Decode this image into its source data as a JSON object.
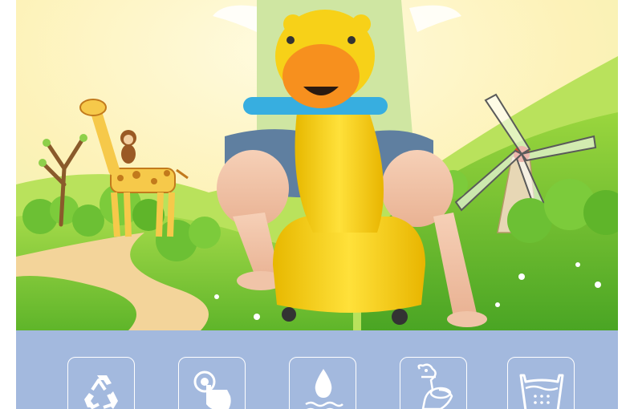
{
  "colors": {
    "sky": "#fdf7c9",
    "grass": "#8fd13c",
    "path": "#f3d49a",
    "toy_yellow": "#f7d118",
    "toy_face": "#f7901e",
    "handle": "#37aee0",
    "feature_band": "#a3b9de",
    "icon_stroke": "#ffffff"
  },
  "hero": {
    "image": "child-riding-giraffe-potty-in-cartoon-meadow",
    "elements": [
      "giraffe-cartoon",
      "monkey-cartoon",
      "tree-cartoon",
      "windmill",
      "hills",
      "bushes",
      "child",
      "giraffe-potty-toy"
    ]
  },
  "features": {
    "items": [
      {
        "icon": "recycle-icon",
        "label": ""
      },
      {
        "icon": "touch-button-icon",
        "label": ""
      },
      {
        "icon": "water-drop-icon",
        "label": ""
      },
      {
        "icon": "potty-seat-icon",
        "label": ""
      },
      {
        "icon": "washable-basin-icon",
        "label": ""
      }
    ]
  }
}
